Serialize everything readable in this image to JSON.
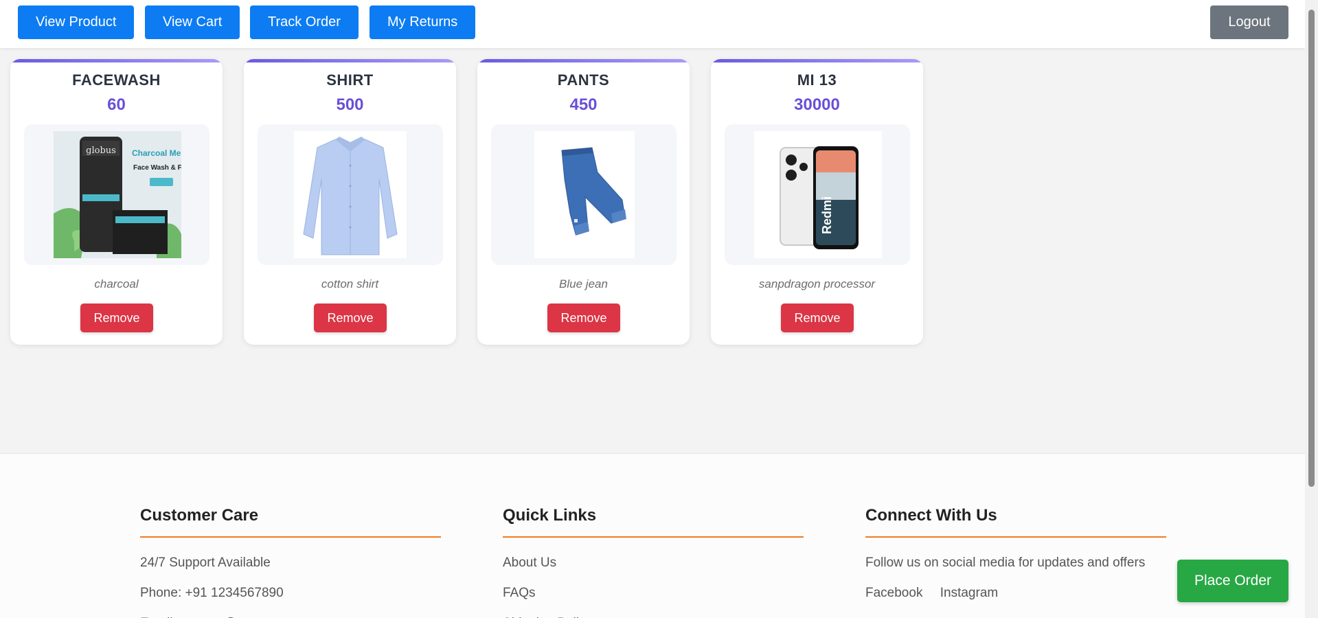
{
  "nav": {
    "view_product": "View Product",
    "view_cart": "View Cart",
    "track_order": "Track Order",
    "my_returns": "My Returns",
    "logout": "Logout"
  },
  "cart": {
    "items": [
      {
        "name": "FACEWASH",
        "price": "60",
        "description": "charcoal",
        "image_icon": "facewash-product-image",
        "remove_label": "Remove"
      },
      {
        "name": "SHIRT",
        "price": "500",
        "description": "cotton shirt",
        "image_icon": "shirt-product-image",
        "remove_label": "Remove"
      },
      {
        "name": "PANTS",
        "price": "450",
        "description": "Blue jean",
        "image_icon": "jeans-product-image",
        "remove_label": "Remove"
      },
      {
        "name": "MI 13",
        "price": "30000",
        "description": "sanpdragon processor",
        "image_icon": "phone-product-image",
        "remove_label": "Remove"
      }
    ]
  },
  "product_image_text": {
    "facewash_brand": "globus",
    "facewash_headline": "Charcoal Men",
    "facewash_subline": "Face Wash & Facial Kit",
    "phone_brand": "Redmi"
  },
  "footer": {
    "customer_care": {
      "title": "Customer Care",
      "lines": [
        "24/7 Support Available",
        "Phone: +91 1234567890",
        "Email: support@yourstore.com"
      ]
    },
    "quick_links": {
      "title": "Quick Links",
      "links": [
        "About Us",
        "FAQs",
        "Shipping Policy"
      ]
    },
    "connect": {
      "title": "Connect With Us",
      "text": "Follow us on social media for updates and offers",
      "social": [
        "Facebook",
        "Instagram"
      ]
    }
  },
  "place_order_label": "Place Order",
  "colors": {
    "primary": "#0d7cf2",
    "logout": "#6c757d",
    "remove": "#dc3545",
    "place_order": "#28a745",
    "price": "#6a4fd6",
    "footer_accent": "#f07a22"
  }
}
